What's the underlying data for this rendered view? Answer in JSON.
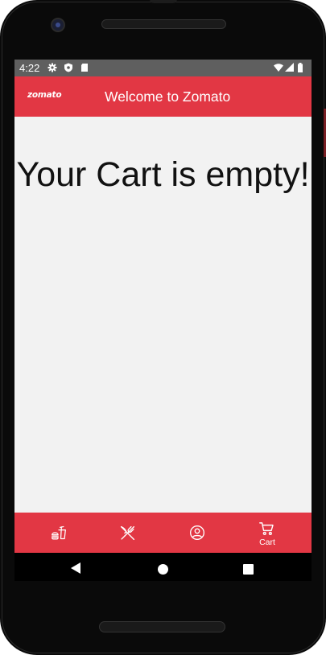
{
  "status_bar": {
    "time": "4:22",
    "icons": [
      "settings-gear-icon",
      "shield-icon",
      "sd-card-icon",
      "wifi-icon",
      "signal-icon",
      "battery-icon"
    ]
  },
  "app_bar": {
    "logo_text": "zomato",
    "title": "Welcome to Zomato",
    "background": "#e23744"
  },
  "content": {
    "empty_message": "Your Cart is empty!"
  },
  "bottom_nav": {
    "background": "#e23744",
    "items": [
      {
        "icon": "fast-food-icon",
        "label": ""
      },
      {
        "icon": "fork-knife-icon",
        "label": ""
      },
      {
        "icon": "account-circle-icon",
        "label": ""
      },
      {
        "icon": "cart-icon",
        "label": "Cart"
      }
    ],
    "selected": "Cart"
  },
  "system_nav": {
    "icons": [
      "back-icon",
      "home-icon",
      "recents-icon"
    ]
  }
}
